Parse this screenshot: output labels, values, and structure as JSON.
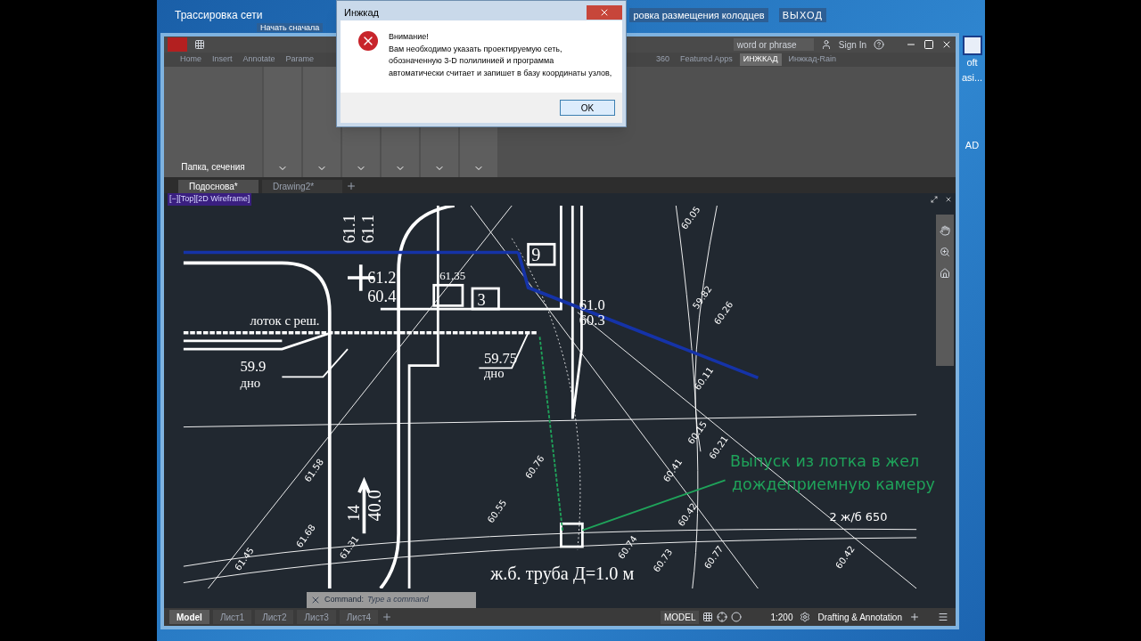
{
  "desktop": {
    "windows_behind": [
      "Трассировка сети",
      "Начать сначала",
      "ровка размещения колодцев",
      "ВЫХОД"
    ],
    "icon_labels": [
      "oft",
      "asi...",
      "AD"
    ]
  },
  "app": {
    "search": {
      "placeholder": "word or phrase"
    },
    "sign_in": "Sign In",
    "ribbon_tabs": [
      {
        "label": "Home",
        "selected": false
      },
      {
        "label": "Insert",
        "selected": false
      },
      {
        "label": "Annotate",
        "selected": false
      },
      {
        "label": "Parame",
        "selected": false
      },
      {
        "label": "360",
        "selected": false
      },
      {
        "label": "Featured Apps",
        "selected": false
      },
      {
        "label": "ИНЖКАД",
        "selected": true
      },
      {
        "label": "Инжкад-Rain",
        "selected": false
      }
    ],
    "ribbon_panel": {
      "title": "Папка, сечения"
    },
    "doc_tabs": [
      {
        "label": "Подоснова*",
        "selected": true
      },
      {
        "label": "Drawing2*",
        "selected": false
      }
    ],
    "viewport_label": "[−][Top][2D Wireframe]",
    "drawing_labels": [
      {
        "text": "61.1",
        "kind": "serif"
      },
      {
        "text": "61.1",
        "kind": "serif"
      },
      {
        "text": "61.2",
        "kind": "serif"
      },
      {
        "text": "60.4",
        "kind": "serif"
      },
      {
        "text": "61.35",
        "kind": "serif"
      },
      {
        "text": "3",
        "kind": "serif"
      },
      {
        "text": "9",
        "kind": "serif"
      },
      {
        "text": "лоток с реш.",
        "kind": "serif"
      },
      {
        "text": "59.9",
        "kind": "serif"
      },
      {
        "text": "дно",
        "kind": "serif"
      },
      {
        "text": "59.75",
        "kind": "serif"
      },
      {
        "text": "дно",
        "kind": "serif"
      },
      {
        "text": "61.0",
        "kind": "serif"
      },
      {
        "text": "60.3",
        "kind": "serif"
      },
      {
        "text": "14",
        "kind": "serif"
      },
      {
        "text": "40.0",
        "kind": "serif"
      },
      {
        "text": "Выпуск из лотка в жел",
        "kind": "note"
      },
      {
        "text": "дождеприемную камеру",
        "kind": "note"
      },
      {
        "text": "2 ж/б 650",
        "kind": "plain"
      },
      {
        "text": "ж.б. труба Д=1.0 м",
        "kind": "serif"
      }
    ],
    "elevations": [
      "60.05",
      "59.82",
      "60.26",
      "60.11",
      "60.15",
      "60.21",
      "60.41",
      "60.42",
      "61.58",
      "60.76",
      "60.55",
      "61.68",
      "61.31",
      "61.45",
      "60.74",
      "60.73",
      "60.77",
      "60.42"
    ],
    "command": {
      "label": "Command:",
      "placeholder": "Type a command"
    },
    "layout_tabs": [
      {
        "label": "Model",
        "selected": true
      },
      {
        "label": "Лист1",
        "selected": false
      },
      {
        "label": "Лист2",
        "selected": false
      },
      {
        "label": "Лист3",
        "selected": false
      },
      {
        "label": "Лист4",
        "selected": false
      }
    ],
    "status": {
      "mode": "MODEL",
      "scale": "1:200",
      "workspace": "Drafting & Annotation"
    }
  },
  "dialog": {
    "title": "Инжкад",
    "heading": "Внимание!",
    "message": [
      "Вам необходимо указать проектируемую сеть,",
      "обозначенную 3-D полилинией и программа",
      "автоматически считает и запишет в базу координаты узлов,"
    ],
    "button": "OK"
  }
}
